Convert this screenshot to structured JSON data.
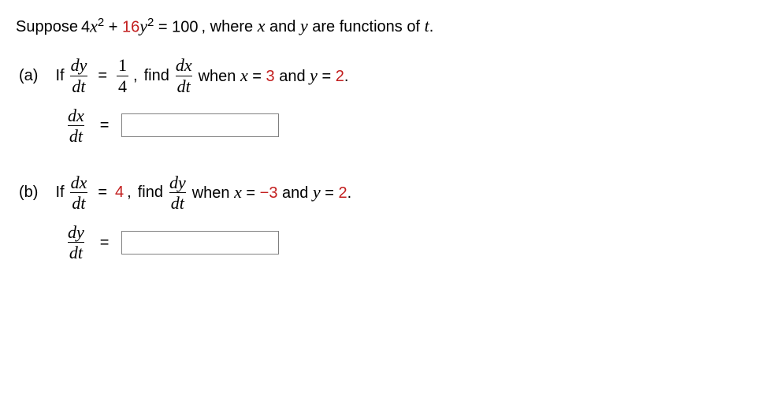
{
  "problem": {
    "prefix": "Suppose ",
    "eq_lhs_coef1": "4",
    "eq_var1": "x",
    "eq_exp1": "2",
    "eq_plus": " + ",
    "eq_lhs_coef2": "16",
    "eq_var2": "y",
    "eq_exp2": "2",
    "eq_eq": " = ",
    "eq_rhs": "100",
    "suffix_1": ", where ",
    "suffix_varx": "x",
    "suffix_and": " and ",
    "suffix_vary": "y",
    "suffix_2": " are functions of ",
    "suffix_vart": "t",
    "suffix_dot": "."
  },
  "partA": {
    "label": "(a)",
    "if": "If",
    "dydt_num": "dy",
    "dydt_den": "dt",
    "eq1": "=",
    "frac_num": "1",
    "frac_den": "4",
    "comma": ",",
    "find": "find",
    "dxdt_num": "dx",
    "dxdt_den": "dt",
    "when": "when ",
    "x": "x",
    "eq2": " = ",
    "xval": "3",
    "and": " and ",
    "y": "y",
    "eq3": " = ",
    "yval": "2",
    "dot": ".",
    "ans_num": "dx",
    "ans_den": "dt",
    "ans_eq": "=",
    "ans_value": ""
  },
  "partB": {
    "label": "(b)",
    "if": "If",
    "dxdt_num": "dx",
    "dxdt_den": "dt",
    "eq1": "=",
    "val": "4",
    "comma": ",",
    "find": "find",
    "dydt_num": "dy",
    "dydt_den": "dt",
    "when": "when ",
    "x": "x",
    "eq2": " = ",
    "xval": "−3",
    "and": " and ",
    "y": "y",
    "eq3": " = ",
    "yval": "2",
    "dot": ".",
    "ans_num": "dy",
    "ans_den": "dt",
    "ans_eq": "=",
    "ans_value": ""
  }
}
